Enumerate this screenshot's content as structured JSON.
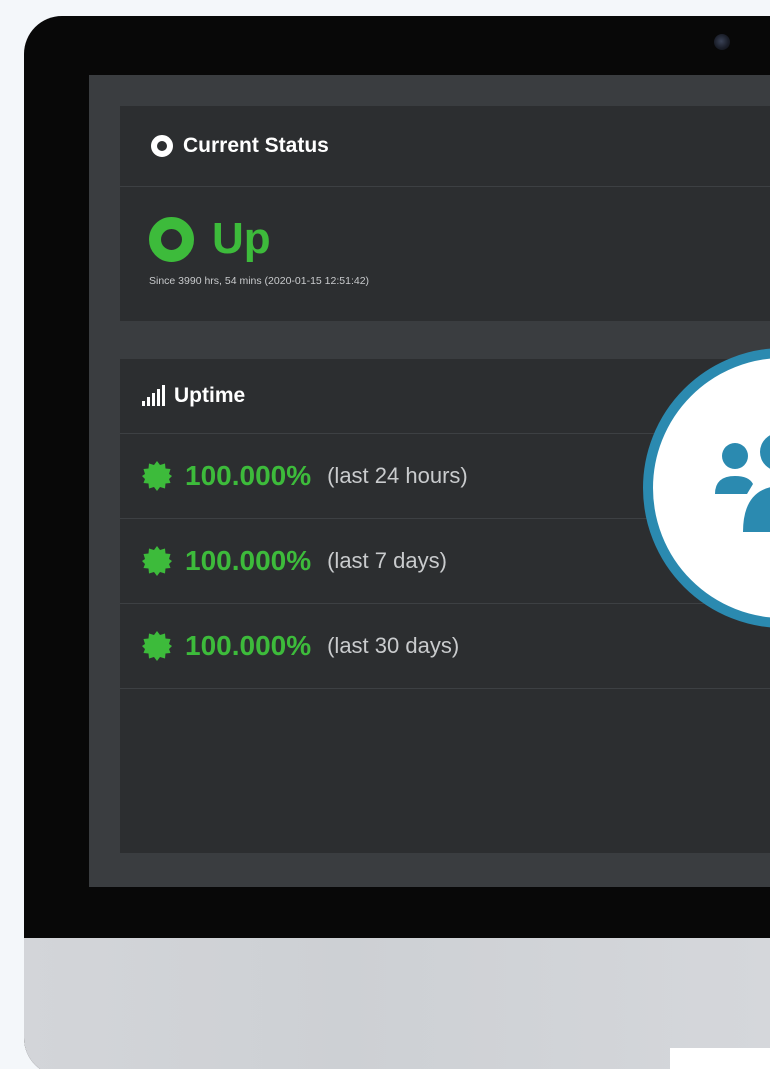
{
  "current_status": {
    "header_icon": "ring-icon",
    "title": "Current Status",
    "state_icon": "ring-icon",
    "state": "Up",
    "state_color": "#3dbb3b",
    "since": "Since 3990 hrs, 54 mins (2020-01-15 12:51:42)"
  },
  "uptime": {
    "header_icon": "signal-bars-icon",
    "title": "Uptime",
    "rows": [
      {
        "icon": "badge-check-icon",
        "percent": "100.000%",
        "period": "(last 24 hours)"
      },
      {
        "icon": "badge-check-icon",
        "percent": "100.000%",
        "period": "(last 7 days)"
      },
      {
        "icon": "badge-check-icon",
        "percent": "100.000%",
        "period": "(last 30 days)"
      }
    ]
  },
  "overlay": {
    "icon": "team-users-icon",
    "accent": "#2b8ab0"
  },
  "theme": {
    "panel_bg": "#2c2e30",
    "screen_bg": "#3a3d40",
    "success": "#3dbb3b"
  }
}
